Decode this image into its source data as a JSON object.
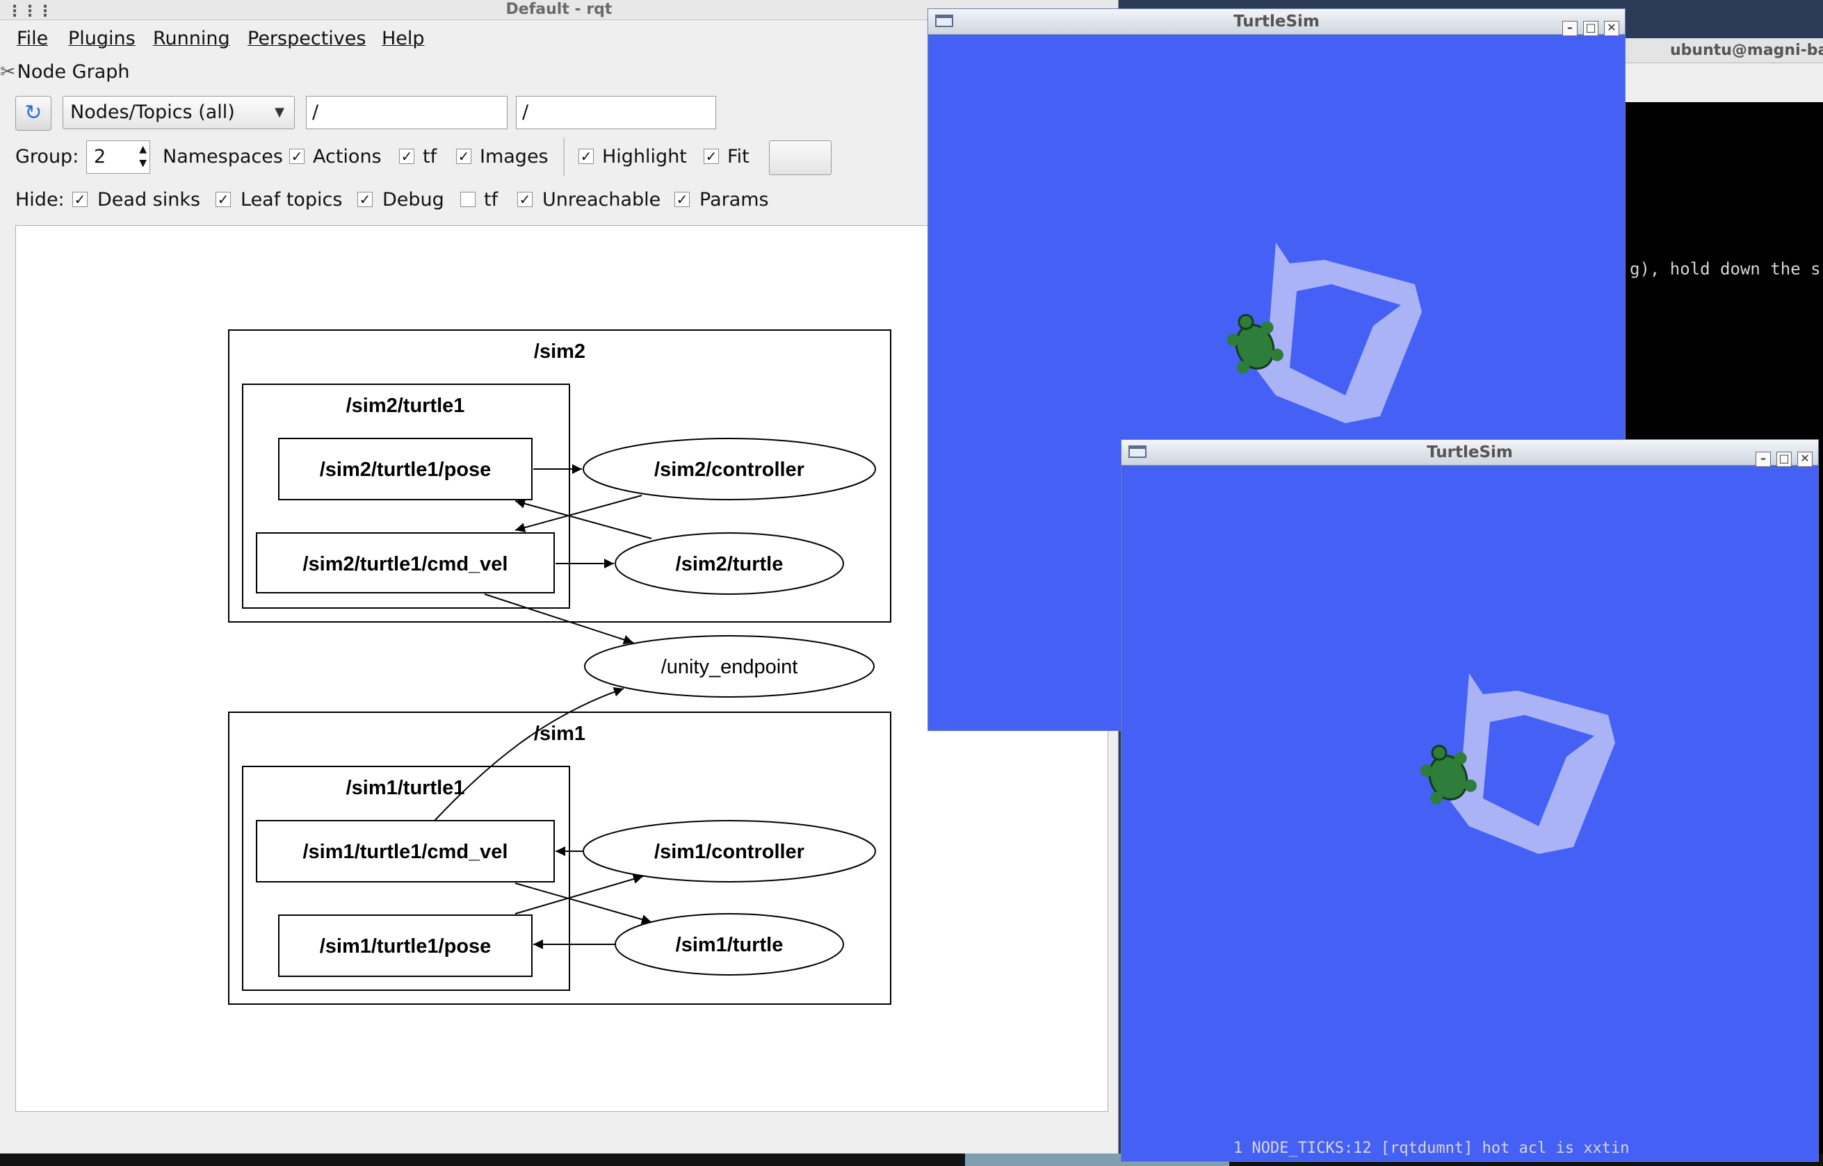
{
  "terminal": {
    "title": "ubuntu@magni-ba",
    "line1": "g), hold down the s",
    "bottom_line": "1 NODE_TICKS:12 [rqtdumnt] hot acl is xxtin"
  },
  "rqt": {
    "window_title": "Default - rqt",
    "menu": {
      "file": "File",
      "plugins": "Plugins",
      "running": "Running",
      "perspectives": "Perspectives",
      "help": "Help"
    },
    "plugin_title": "Node Graph",
    "combo_value": "Nodes/Topics (all)",
    "filter1": "/",
    "filter2": "/",
    "group_label": "Group:",
    "group_value": "2",
    "namespaces_label": "Namespaces",
    "actions_label": "Actions",
    "tf_label": "tf",
    "images_label": "Images",
    "highlight_label": "Highlight",
    "fit_label": "Fit",
    "hide_label": "Hide:",
    "dead_sinks_label": "Dead sinks",
    "leaf_topics_label": "Leaf topics",
    "debug_label": "Debug",
    "hide_tf_label": "tf",
    "unreachable_label": "Unreachable",
    "params_label": "Params",
    "check": "✓",
    "checks": {
      "namespaces": true,
      "actions": true,
      "tf": true,
      "images": true,
      "highlight": true,
      "fit": true,
      "dead_sinks": true,
      "leaf_topics": true,
      "debug": true,
      "hide_tf": false,
      "unreachable": true,
      "params": true
    }
  },
  "graph": {
    "cluster_sim2": "/sim2",
    "cluster_sim2_turtle1": "/sim2/turtle1",
    "sim2_pose": "/sim2/turtle1/pose",
    "sim2_cmd_vel": "/sim2/turtle1/cmd_vel",
    "sim2_controller": "/sim2/controller",
    "sim2_turtle": "/sim2/turtle",
    "unity_endpoint": "/unity_endpoint",
    "cluster_sim1": "/sim1",
    "cluster_sim1_turtle1": "/sim1/turtle1",
    "sim1_cmd_vel": "/sim1/turtle1/cmd_vel",
    "sim1_pose": "/sim1/turtle1/pose",
    "sim1_controller": "/sim1/controller",
    "sim1_turtle": "/sim1/turtle"
  },
  "turtlesim": [
    {
      "title": "TurtleSim"
    },
    {
      "title": "TurtleSim"
    }
  ],
  "colors": {
    "turtlesim_bg": "#4561f5",
    "trail": "#b4bdf6",
    "turtle": "#2e7d3a"
  }
}
